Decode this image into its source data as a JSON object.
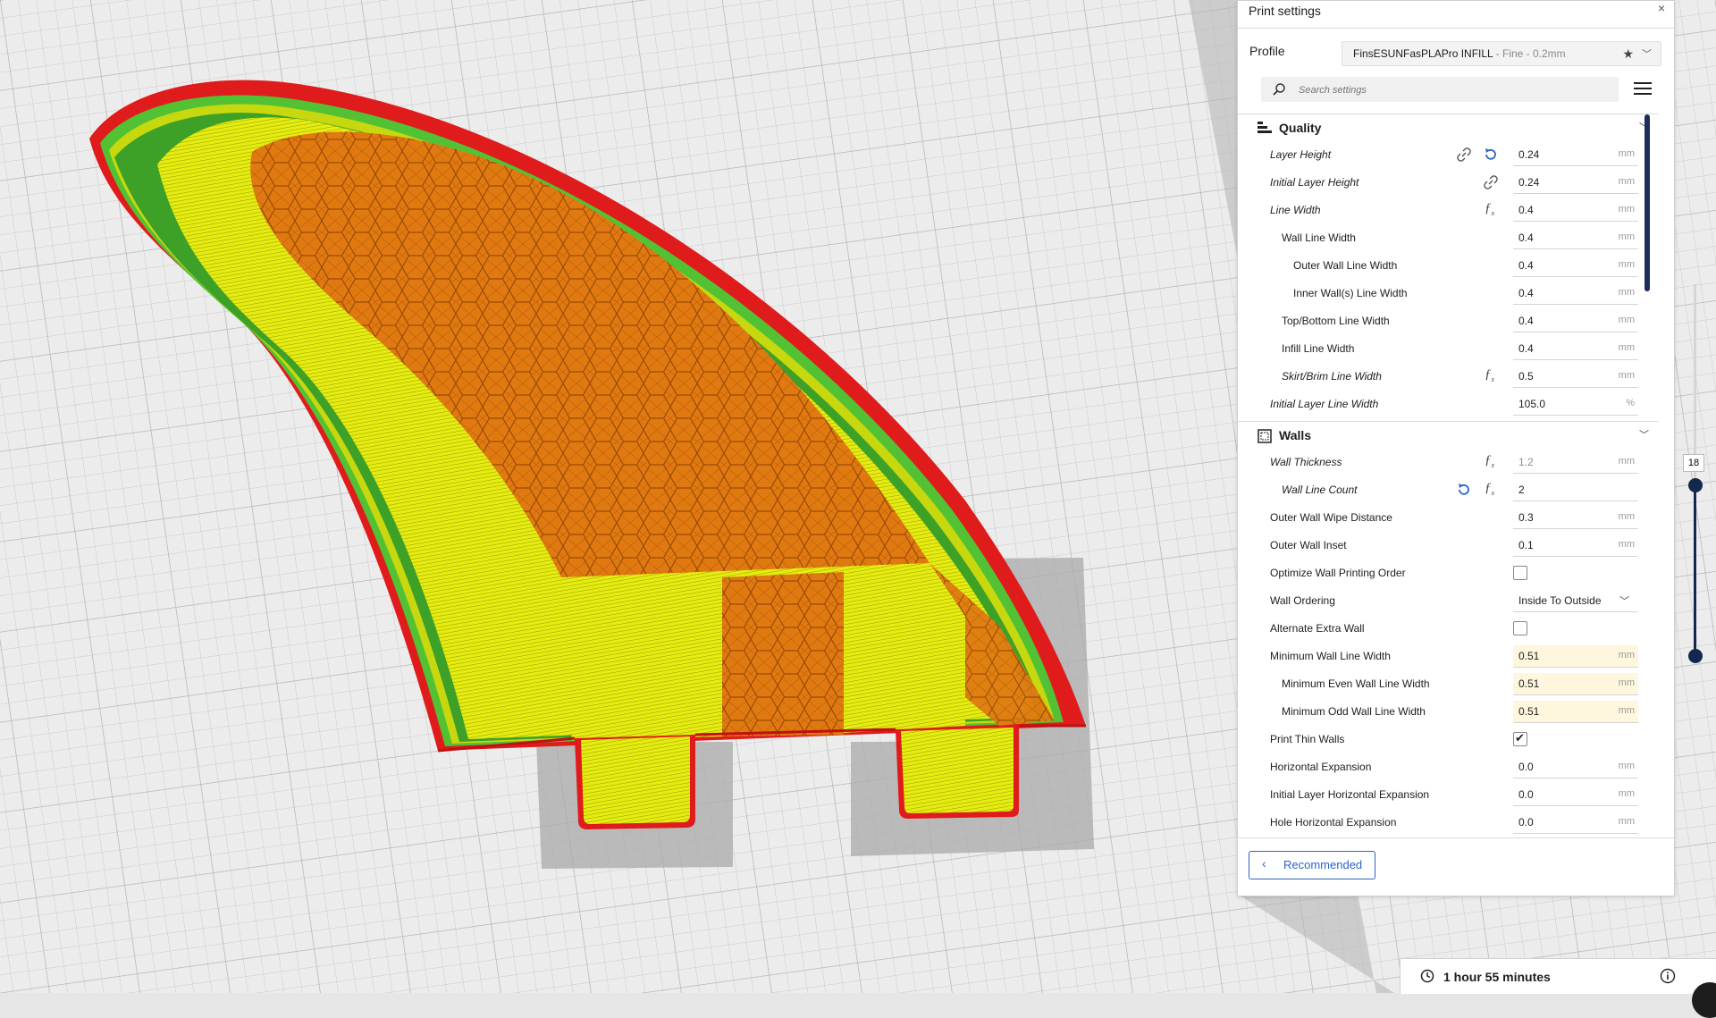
{
  "panel": {
    "title": "Print settings",
    "close_icon": "×",
    "profile_label": "Profile",
    "profile_name": "FinsESUNFasPLAPro INFILL",
    "profile_quality": " - Fine - 0.2mm",
    "search_placeholder": "Search settings",
    "recommended_label": "Recommended"
  },
  "categories": {
    "quality": "Quality",
    "walls": "Walls"
  },
  "quality_rows": [
    {
      "label": "Layer Height",
      "value": "0.24",
      "unit": "mm"
    },
    {
      "label": "Initial Layer Height",
      "value": "0.24",
      "unit": "mm"
    },
    {
      "label": "Line Width",
      "value": "0.4",
      "unit": "mm"
    },
    {
      "label": "Wall Line Width",
      "value": "0.4",
      "unit": "mm"
    },
    {
      "label": "Outer Wall Line Width",
      "value": "0.4",
      "unit": "mm"
    },
    {
      "label": "Inner Wall(s) Line Width",
      "value": "0.4",
      "unit": "mm"
    },
    {
      "label": "Top/Bottom Line Width",
      "value": "0.4",
      "unit": "mm"
    },
    {
      "label": "Infill Line Width",
      "value": "0.4",
      "unit": "mm"
    },
    {
      "label": "Skirt/Brim Line Width",
      "value": "0.5",
      "unit": "mm"
    },
    {
      "label": "Initial Layer Line Width",
      "value": "105.0",
      "unit": "%"
    }
  ],
  "walls_rows": [
    {
      "label": "Wall Thickness",
      "value": "1.2",
      "unit": "mm"
    },
    {
      "label": "Wall Line Count",
      "value": "2",
      "unit": ""
    },
    {
      "label": "Outer Wall Wipe Distance",
      "value": "0.3",
      "unit": "mm"
    },
    {
      "label": "Outer Wall Inset",
      "value": "0.1",
      "unit": "mm"
    },
    {
      "label": "Optimize Wall Printing Order",
      "checked": false
    },
    {
      "label": "Wall Ordering",
      "value": "Inside To Outside"
    },
    {
      "label": "Alternate Extra Wall",
      "checked": false
    },
    {
      "label": "Minimum Wall Line Width",
      "value": "0.51",
      "unit": "mm"
    },
    {
      "label": "Minimum Even Wall Line Width",
      "value": "0.51",
      "unit": "mm"
    },
    {
      "label": "Minimum Odd Wall Line Width",
      "value": "0.51",
      "unit": "mm"
    },
    {
      "label": "Print Thin Walls",
      "checked": true
    },
    {
      "label": "Horizontal Expansion",
      "value": "0.0",
      "unit": "mm"
    },
    {
      "label": "Initial Layer Horizontal Expansion",
      "value": "0.0",
      "unit": "mm"
    },
    {
      "label": "Hole Horizontal Expansion",
      "value": "0.0",
      "unit": "mm"
    }
  ],
  "layer": {
    "current": "18"
  },
  "estimate": {
    "time": "1 hour 55 minutes"
  },
  "colors": {
    "accent": "#2b64c8",
    "slider": "#14284d",
    "wall_outer": "#e01b1b",
    "wall_inner": "#52c234",
    "skin": "#e6ec10",
    "infill": "#e07a10"
  }
}
